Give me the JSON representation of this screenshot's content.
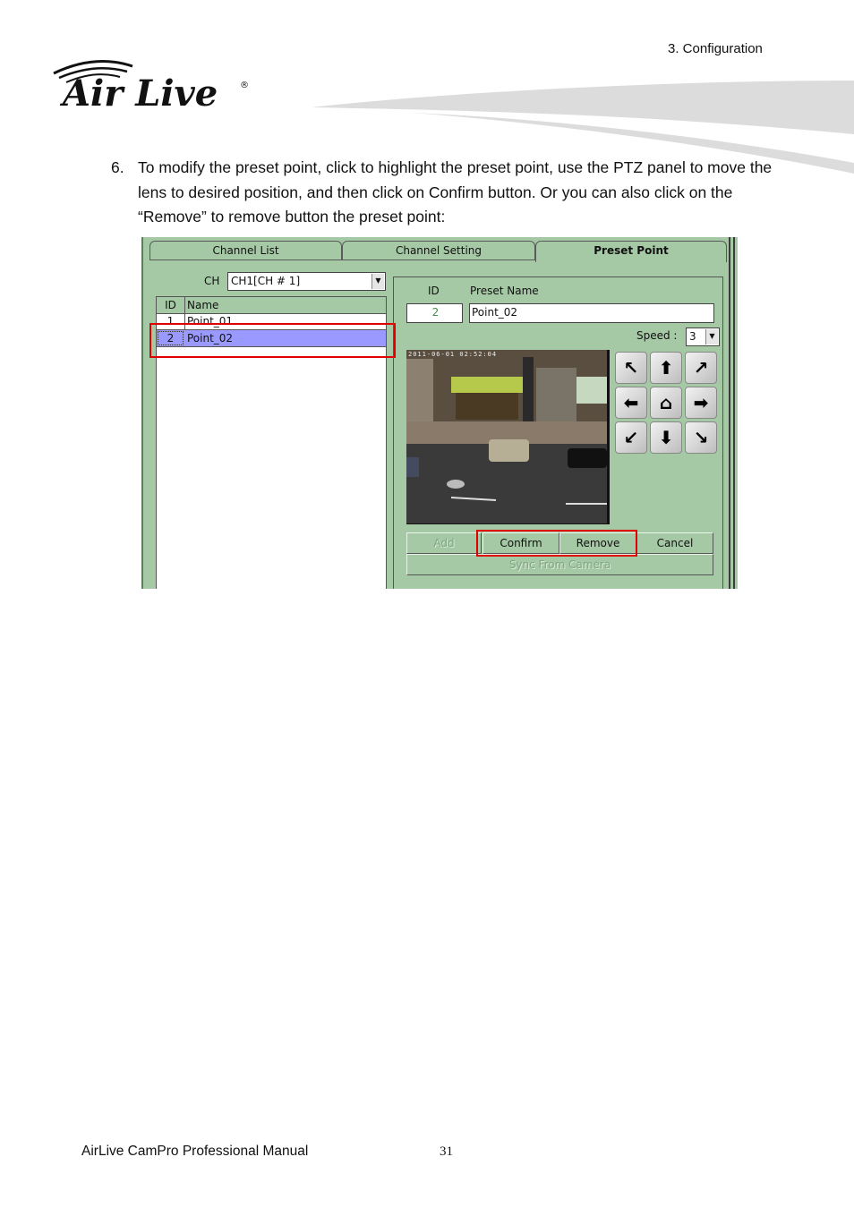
{
  "header": {
    "chapter": "3.  Configuration",
    "logo_text": "Air Live",
    "logo_mark": "®"
  },
  "step": {
    "number": "6.",
    "text": "To modify the preset point, click to highlight the preset point, use the PTZ panel to move the lens to desired position, and then click on Confirm button. Or you can also click on the “Remove” to remove button the preset point:"
  },
  "ui": {
    "tabs": [
      {
        "label": "Channel List",
        "active": false
      },
      {
        "label": "Channel Setting",
        "active": false
      },
      {
        "label": "Preset Point",
        "active": true
      }
    ],
    "ch_label": "CH",
    "ch_select": "CH1[CH # 1]",
    "list": {
      "columns": [
        "ID",
        "Name"
      ],
      "rows": [
        {
          "id": "1",
          "name": "Point_01",
          "selected": false
        },
        {
          "id": "2",
          "name": "Point_02",
          "selected": true
        }
      ]
    },
    "form": {
      "id_label": "ID",
      "name_label": "Preset Name",
      "id_value": "2",
      "name_value": "Point_02",
      "speed_label": "Speed :",
      "speed_value": "3"
    },
    "camera": {
      "timestamp": "2011-06-01  02:52:04"
    },
    "ptz": [
      "arrow-up-left",
      "arrow-up",
      "arrow-up-right",
      "arrow-left",
      "home",
      "arrow-right",
      "arrow-down-left",
      "arrow-down",
      "arrow-down-right"
    ],
    "buttons": {
      "add": "Add",
      "confirm": "Confirm",
      "remove": "Remove",
      "cancel": "Cancel",
      "sync": "Sync From Camera"
    },
    "highlight_color": "#e00000",
    "selection_color": "#9999ff",
    "panel_color": "#a5c8a5"
  },
  "footer": {
    "manual": "AirLive  CamPro  Professional  Manual",
    "page": "31"
  }
}
